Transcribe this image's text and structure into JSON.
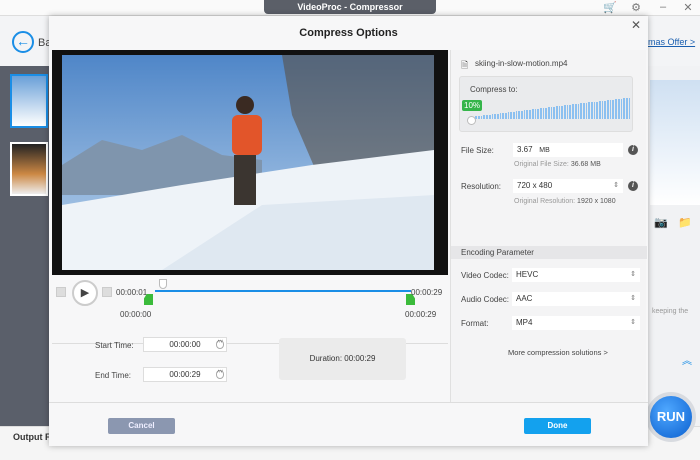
{
  "window": {
    "title": "VideoProc - Compressor",
    "cart_icon": "cart-icon",
    "settings_icon": "gear-icon",
    "minimize": "–",
    "close": "✕"
  },
  "background": {
    "back_label": "Ba",
    "offer_link": "mas Offer >",
    "output_label": "Output F",
    "run_label": "RUN",
    "keeping_text": "keeping the"
  },
  "dialog": {
    "title": "Compress Options",
    "close": "✕",
    "player": {
      "current_time": "00:00:01",
      "end_time_top": "00:00:29",
      "trim_start": "00:00:00",
      "trim_end": "00:00:29"
    },
    "trim": {
      "start_label": "Start Time:",
      "start_value": "00:00:00",
      "end_label": "End Time:",
      "end_value": "00:00:29",
      "duration_label": "Duration:",
      "duration_value": "00:00:29"
    },
    "right": {
      "filename": "skiing-in-slow-motion.mp4",
      "compress_label": "Compress to:",
      "compress_percent": "10%",
      "compress_value": 0.1,
      "file_size_label": "File Size:",
      "file_size_value": "3.67",
      "file_size_unit": "MB",
      "original_size_label": "Original File Size:",
      "original_size_value": "36.68 MB",
      "resolution_label": "Resolution:",
      "resolution_value": "720 x 480",
      "original_res_label": "Original Resolution:",
      "original_res_value": "1920 x 1080",
      "encoding_header": "Encoding Parameter",
      "video_codec_label": "Video Codec:",
      "video_codec_value": "HEVC",
      "audio_codec_label": "Audio Codec:",
      "audio_codec_value": "AAC",
      "format_label": "Format:",
      "format_value": "MP4",
      "more_link": "More compression solutions >"
    },
    "cancel": "Cancel",
    "done": "Done"
  }
}
